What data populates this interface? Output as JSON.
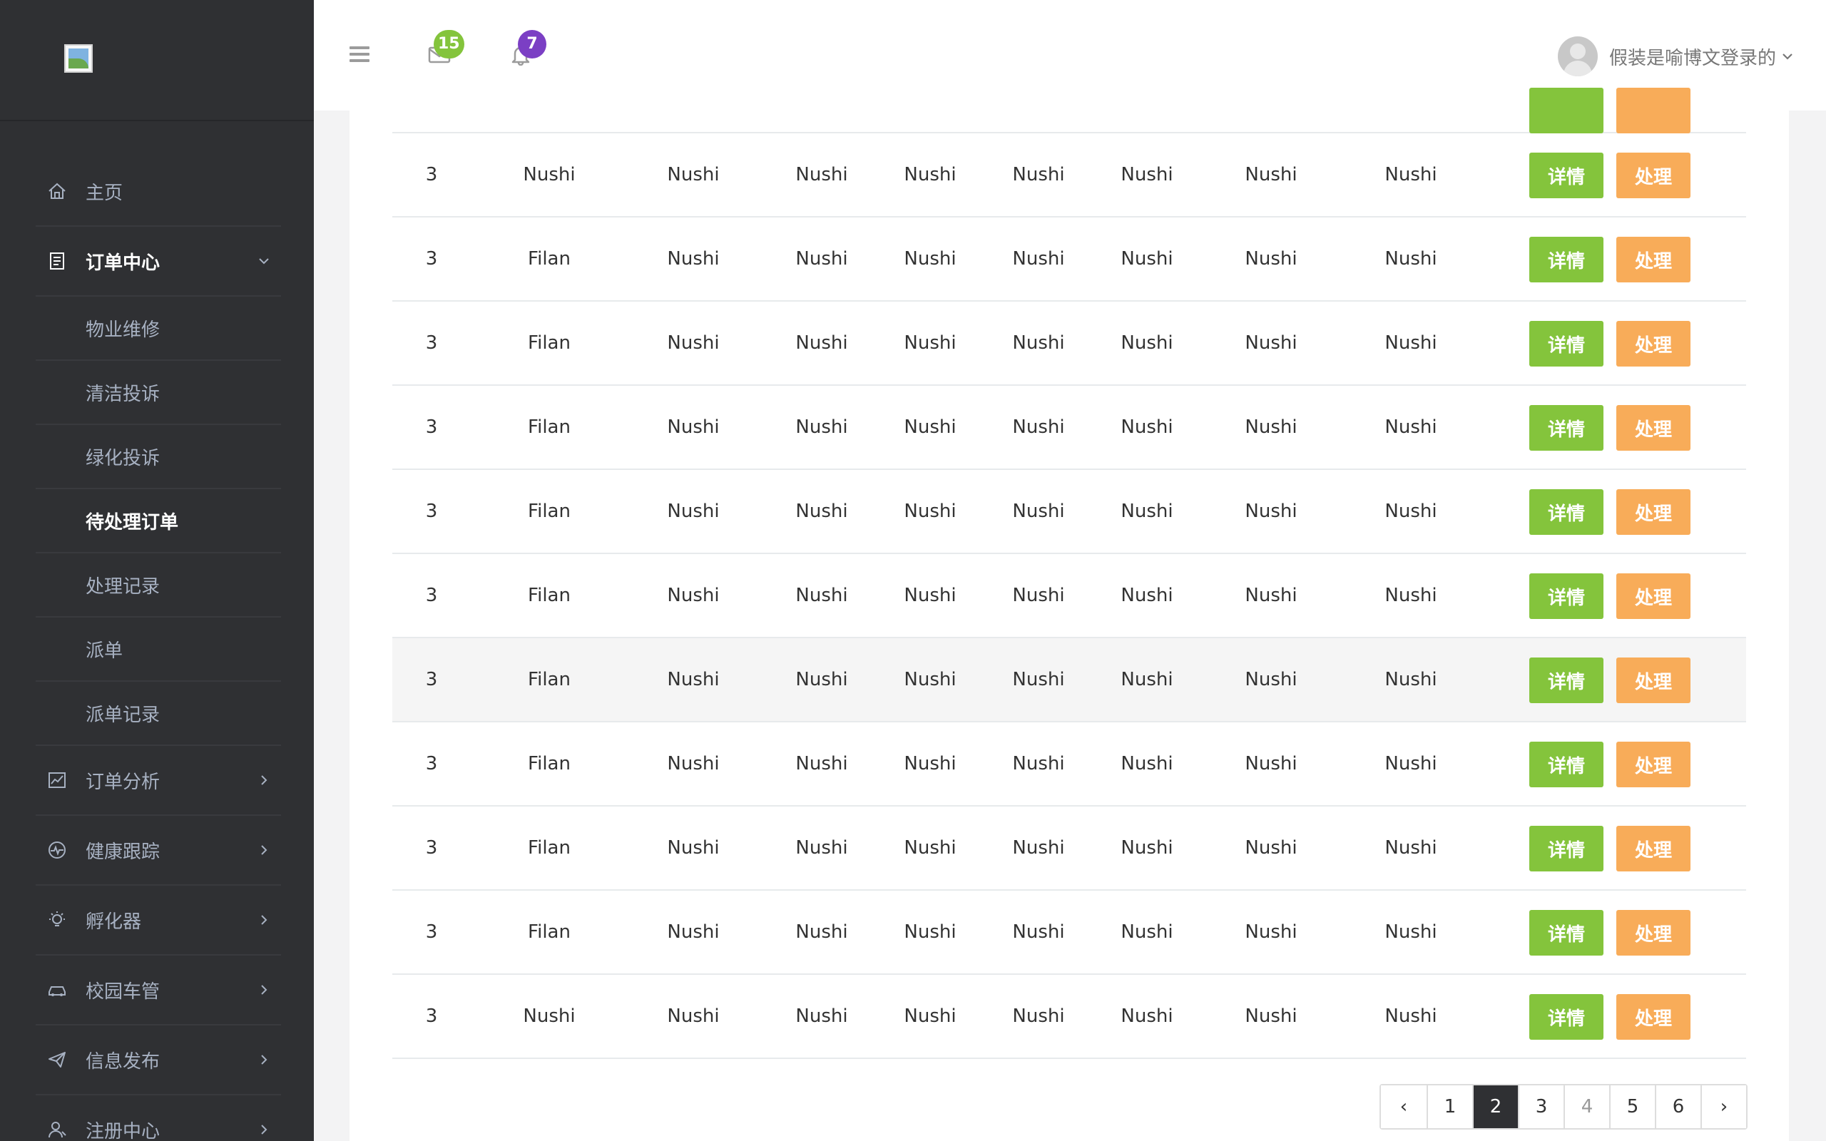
{
  "sidebar": {
    "items": [
      {
        "label": "主页",
        "icon": "home-icon"
      },
      {
        "label": "订单中心",
        "icon": "document-icon",
        "expanded": true
      },
      {
        "label": "订单分析",
        "icon": "chart-icon"
      },
      {
        "label": "健康跟踪",
        "icon": "heartbeat-icon"
      },
      {
        "label": "孵化器",
        "icon": "lightbulb-icon"
      },
      {
        "label": "校园车管",
        "icon": "car-icon"
      },
      {
        "label": "信息发布",
        "icon": "paper-plane-icon"
      },
      {
        "label": "注册中心",
        "icon": "user-icon"
      }
    ],
    "submenu": [
      {
        "label": "物业维修"
      },
      {
        "label": "清洁投诉"
      },
      {
        "label": "绿化投诉"
      },
      {
        "label": "待处理订单",
        "active": true
      },
      {
        "label": "处理记录"
      },
      {
        "label": "派单"
      },
      {
        "label": "派单记录"
      }
    ]
  },
  "topbar": {
    "mail_count": "15",
    "mail_badge_color": "#84c43c",
    "notify_count": "7",
    "notify_badge_color": "#7b3fc4",
    "user_name": "假装是喻博文登录的"
  },
  "table": {
    "rows": [
      [
        "3",
        "Nushi",
        "Nushi",
        "Nushi",
        "Nushi",
        "Nushi",
        "Nushi",
        "Nushi",
        "Nushi"
      ],
      [
        "3",
        "Filan",
        "Nushi",
        "Nushi",
        "Nushi",
        "Nushi",
        "Nushi",
        "Nushi",
        "Nushi"
      ],
      [
        "3",
        "Filan",
        "Nushi",
        "Nushi",
        "Nushi",
        "Nushi",
        "Nushi",
        "Nushi",
        "Nushi"
      ],
      [
        "3",
        "Filan",
        "Nushi",
        "Nushi",
        "Nushi",
        "Nushi",
        "Nushi",
        "Nushi",
        "Nushi"
      ],
      [
        "3",
        "Filan",
        "Nushi",
        "Nushi",
        "Nushi",
        "Nushi",
        "Nushi",
        "Nushi",
        "Nushi"
      ],
      [
        "3",
        "Filan",
        "Nushi",
        "Nushi",
        "Nushi",
        "Nushi",
        "Nushi",
        "Nushi",
        "Nushi"
      ],
      [
        "3",
        "Filan",
        "Nushi",
        "Nushi",
        "Nushi",
        "Nushi",
        "Nushi",
        "Nushi",
        "Nushi"
      ],
      [
        "3",
        "Filan",
        "Nushi",
        "Nushi",
        "Nushi",
        "Nushi",
        "Nushi",
        "Nushi",
        "Nushi"
      ],
      [
        "3",
        "Filan",
        "Nushi",
        "Nushi",
        "Nushi",
        "Nushi",
        "Nushi",
        "Nushi",
        "Nushi"
      ],
      [
        "3",
        "Filan",
        "Nushi",
        "Nushi",
        "Nushi",
        "Nushi",
        "Nushi",
        "Nushi",
        "Nushi"
      ],
      [
        "3",
        "Nushi",
        "Nushi",
        "Nushi",
        "Nushi",
        "Nushi",
        "Nushi",
        "Nushi",
        "Nushi"
      ]
    ],
    "detail_label": "详情",
    "handle_label": "处理",
    "detail_color": "#84c43c",
    "handle_color": "#f8ac59"
  },
  "pagination": {
    "prev": "‹",
    "next": "›",
    "pages": [
      "1",
      "2",
      "3",
      "4",
      "5",
      "6"
    ],
    "current": "2"
  }
}
